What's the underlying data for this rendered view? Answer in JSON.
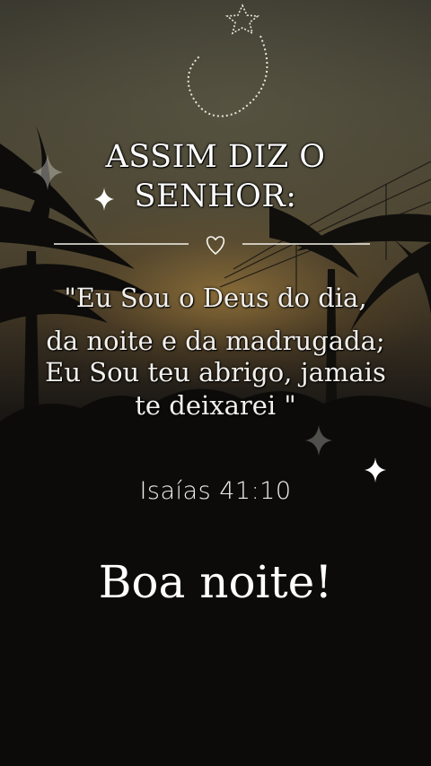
{
  "title": {
    "line1": "ASSIM DIZ O",
    "line2": "SENHOR:"
  },
  "quote": {
    "line1": "\"Eu Sou o Deus do dia,",
    "line2": "da noite e da madrugada;",
    "line3": "Eu Sou teu abrigo, jamais",
    "line4": "te deixarei \""
  },
  "reference": "Isaías 41:10",
  "greeting": "Boa noite!",
  "decorations": {
    "top_ornament": "star-swirl-icon",
    "divider_icon": "heart-outline-icon",
    "sparkles": "four-point-star-icon"
  },
  "colors": {
    "text": "#ffffff",
    "sky_glow": "#c4964a",
    "background_dark": "#0b0b0a"
  }
}
